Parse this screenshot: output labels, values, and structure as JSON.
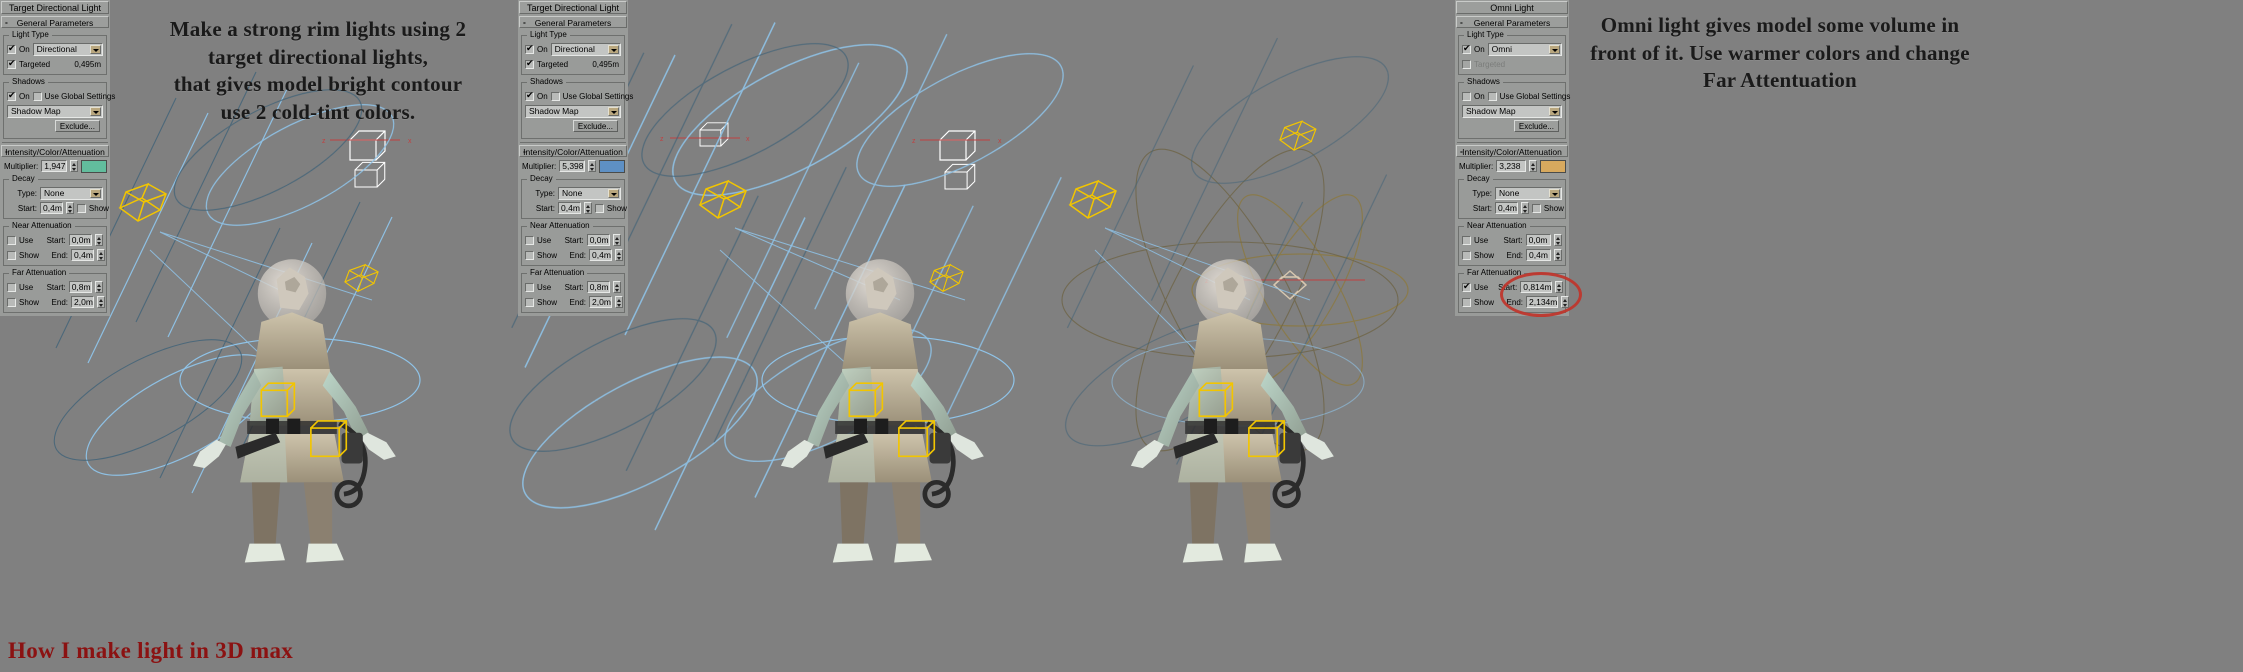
{
  "page": {
    "title_red": "How I make light in 3D max",
    "background_color": "#808080"
  },
  "annotations": {
    "left": "Make a strong rim lights using 2\ntarget directional lights,\nthat gives model bright contour\nuse 2 cold-tint colors.",
    "right": "Omni light gives model some volume in\nfront of it. Use warmer colors and change\nFar Attentuation"
  },
  "panels": [
    {
      "id": "panel-left",
      "object_name": "Target Directional Light",
      "rollout_general": "General Parameters",
      "rollout_minus": "-",
      "light_type": {
        "group_label": "Light Type",
        "on_label": "On",
        "on_checked": true,
        "type_value": "Directional",
        "targeted_label": "Targeted",
        "targeted_checked": true,
        "targeted_enabled": true,
        "target_distance": "0,495m"
      },
      "shadows": {
        "group_label": "Shadows",
        "on_label": "On",
        "on_checked": true,
        "use_global_label": "Use Global Settings",
        "use_global_checked": false,
        "shadow_type": "Shadow Map",
        "exclude_label": "Exclude..."
      },
      "rollout_intensity": "Intensity/Color/Attenuation",
      "intensity": {
        "multiplier_label": "Multiplier:",
        "multiplier_value": "1,947",
        "color_swatch": "#62bd9d"
      },
      "decay": {
        "group_label": "Decay",
        "type_label": "Type:",
        "type_value": "None",
        "start_label": "Start:",
        "start_value": "0,4m",
        "show_label": "Show",
        "show_checked": false
      },
      "near_attenuation": {
        "group_label": "Near Attenuation",
        "use_label": "Use",
        "use_checked": false,
        "show_label": "Show",
        "show_checked": false,
        "start_label": "Start:",
        "start_value": "0,0m",
        "end_label": "End:",
        "end_value": "0,4m"
      },
      "far_attenuation": {
        "group_label": "Far Attenuation",
        "use_label": "Use",
        "use_checked": false,
        "show_label": "Show",
        "show_checked": false,
        "start_label": "Start:",
        "start_value": "0,8m",
        "end_label": "End:",
        "end_value": "2,0m",
        "highlighted": false
      }
    },
    {
      "id": "panel-middle",
      "object_name": "Target Directional Light",
      "rollout_general": "General Parameters",
      "rollout_minus": "-",
      "light_type": {
        "group_label": "Light Type",
        "on_label": "On",
        "on_checked": true,
        "type_value": "Directional",
        "targeted_label": "Targeted",
        "targeted_checked": true,
        "targeted_enabled": true,
        "target_distance": "0,495m"
      },
      "shadows": {
        "group_label": "Shadows",
        "on_label": "On",
        "on_checked": true,
        "use_global_label": "Use Global Settings",
        "use_global_checked": false,
        "shadow_type": "Shadow Map",
        "exclude_label": "Exclude..."
      },
      "rollout_intensity": "Intensity/Color/Attenuation",
      "intensity": {
        "multiplier_label": "Multiplier:",
        "multiplier_value": "5,398",
        "color_swatch": "#5e90c4"
      },
      "decay": {
        "group_label": "Decay",
        "type_label": "Type:",
        "type_value": "None",
        "start_label": "Start:",
        "start_value": "0,4m",
        "show_label": "Show",
        "show_checked": false
      },
      "near_attenuation": {
        "group_label": "Near Attenuation",
        "use_label": "Use",
        "use_checked": false,
        "show_label": "Show",
        "show_checked": false,
        "start_label": "Start:",
        "start_value": "0,0m",
        "end_label": "End:",
        "end_value": "0,4m"
      },
      "far_attenuation": {
        "group_label": "Far Attenuation",
        "use_label": "Use",
        "use_checked": false,
        "show_label": "Show",
        "show_checked": false,
        "start_label": "Start:",
        "start_value": "0,8m",
        "end_label": "End:",
        "end_value": "2,0m",
        "highlighted": false
      }
    },
    {
      "id": "panel-right",
      "object_name": "Omni Light",
      "rollout_general": "General Parameters",
      "rollout_minus": "-",
      "light_type": {
        "group_label": "Light Type",
        "on_label": "On",
        "on_checked": true,
        "type_value": "Omni",
        "targeted_label": "Targeted",
        "targeted_checked": false,
        "targeted_enabled": false,
        "target_distance": ""
      },
      "shadows": {
        "group_label": "Shadows",
        "on_label": "On",
        "on_checked": false,
        "use_global_label": "Use Global Settings",
        "use_global_checked": false,
        "shadow_type": "Shadow Map",
        "exclude_label": "Exclude..."
      },
      "rollout_intensity": "Intensity/Color/Attenuation",
      "intensity": {
        "multiplier_label": "Multiplier:",
        "multiplier_value": "3,238",
        "color_swatch": "#d7a95e"
      },
      "decay": {
        "group_label": "Decay",
        "type_label": "Type:",
        "type_value": "None",
        "start_label": "Start:",
        "start_value": "0,4m",
        "show_label": "Show",
        "show_checked": false
      },
      "near_attenuation": {
        "group_label": "Near Attenuation",
        "use_label": "Use",
        "use_checked": false,
        "show_label": "Show",
        "show_checked": false,
        "start_label": "Start:",
        "start_value": "0,0m",
        "end_label": "End:",
        "end_value": "0,4m"
      },
      "far_attenuation": {
        "group_label": "Far Attenuation",
        "use_label": "Use",
        "use_checked": true,
        "show_label": "Show",
        "show_checked": false,
        "start_label": "Start:",
        "start_value": "0,814m",
        "end_label": "End:",
        "end_value": "2,134m",
        "highlighted": true,
        "highlight_color": "#c0342a"
      }
    }
  ],
  "scene": {
    "gizmo_color_cold": "#8fc3e8",
    "gizmo_color_dark": "#3f6278",
    "gizmo_color_warm": "#8a7a4a",
    "light_icon_color": "#f2c500",
    "axis_x_color": "#c04040",
    "axis_z_label": "z",
    "axis_x_label": "x"
  }
}
